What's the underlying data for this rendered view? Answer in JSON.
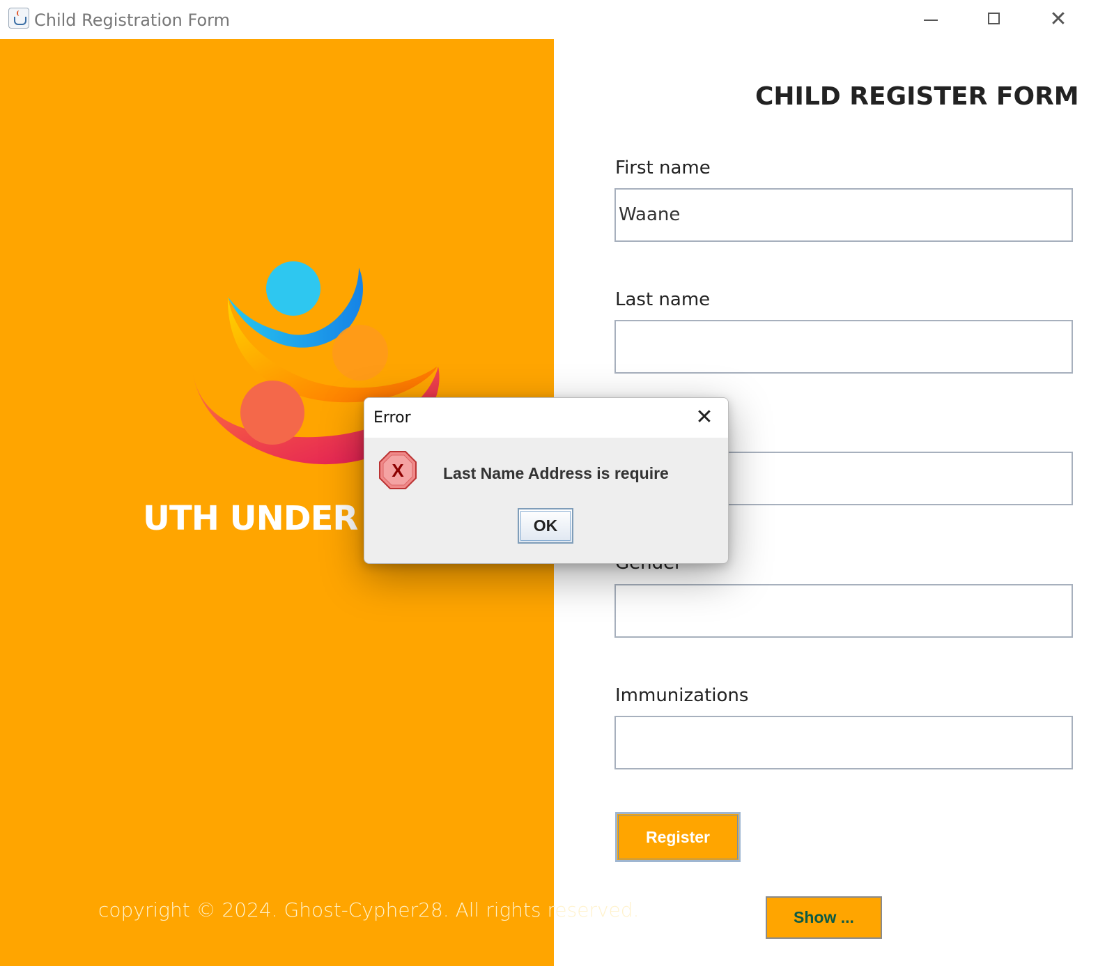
{
  "window": {
    "title": "Child Registration Form",
    "close_glyph": "✕"
  },
  "left_panel": {
    "brand_text": "UTH UNDER 5 I",
    "copyright": "copyright © 2024. Ghost-Cypher28. All rights reserved.",
    "background_color": "#ffa500"
  },
  "form": {
    "title": "CHILD REGISTER FORM",
    "fields": [
      {
        "label": "First name",
        "value": "Waane"
      },
      {
        "label": "Last name",
        "value": ""
      },
      {
        "label": "",
        "value": ""
      },
      {
        "label": "Gender",
        "value": ""
      },
      {
        "label": "Immunizations",
        "value": ""
      }
    ],
    "register_label": "Register",
    "show_label": "Show ..."
  },
  "dialog": {
    "title": "Error",
    "close_glyph": "✕",
    "message": "Last Name Address is require",
    "ok_label": "OK",
    "icon": "error-x-icon"
  }
}
